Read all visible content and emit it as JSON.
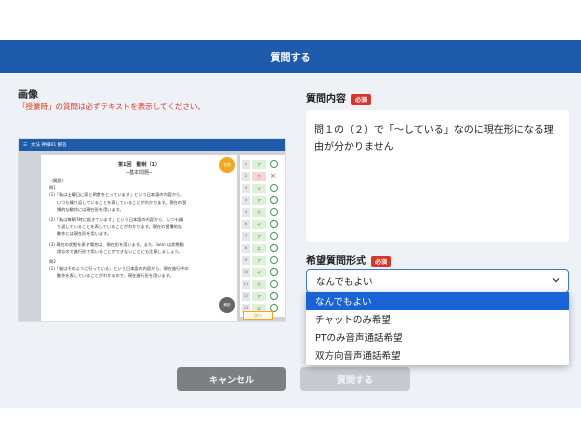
{
  "modal": {
    "title": "質問する"
  },
  "image_section": {
    "label": "画像",
    "warning": "「授業時」の質問は必ずテキストを表示してください。",
    "preview": {
      "app_bar": "文法 神様61 解答",
      "doc_title": "第1回　動制（1）",
      "doc_subtitle": "─基本問題─",
      "doc_lines": [
        "〈解説〉",
        "問1",
        "(1)「私は土曜日に家と朝食をとっています」という日本語の内容から、",
        "いつも繰り返していることを表していることがわかります。現在の習",
        "慣的な動作には現在形を用います。",
        "(2)「私は毎朝7時に起きています」という日本語の内容から、いつも繰",
        "り返していることを表していることがわかります。現在の習慣的な",
        "動作には現在形を用います。",
        "(3) 現在の状態を表す場合は、現在形を用います。また、bem は状態動",
        "詞なので進行形で用いることができないことにも注意しましょう。",
        "問2",
        "(1)「彼はそのように行っている」という日本語の内容から、現在進行中の",
        "動作を表していることがわかるので、現在進行形を用います。"
      ],
      "side_btn_1": "質問",
      "side_btn_2": "解説",
      "answer_rows": [
        {
          "num": "1",
          "val": "ア",
          "status": "ok"
        },
        {
          "num": "2",
          "val": "ウ",
          "status": "bad"
        },
        {
          "num": "3",
          "val": "イ",
          "status": "ok"
        },
        {
          "num": "4",
          "val": "ア",
          "status": "ok"
        },
        {
          "num": "5",
          "val": "ウ",
          "status": "ok"
        },
        {
          "num": "6",
          "val": "イ",
          "status": "ok"
        },
        {
          "num": "7",
          "val": "ア",
          "status": "ok"
        },
        {
          "num": "8",
          "val": "エ",
          "status": "ok"
        },
        {
          "num": "9",
          "val": "ア",
          "status": "ok"
        },
        {
          "num": "10",
          "val": "イ",
          "status": "ok"
        },
        {
          "num": "11",
          "val": "ウ",
          "status": "ok"
        },
        {
          "num": "12",
          "val": "ア",
          "status": "ok"
        },
        {
          "num": "13",
          "val": "エ",
          "status": "ok"
        }
      ],
      "next_btn": "次へ"
    }
  },
  "question_section": {
    "label": "質問内容",
    "required": "必須",
    "text": "問１の（２）で「〜している」なのに現在形になる理由が分かりません"
  },
  "format_section": {
    "label": "希望質問形式",
    "required": "必須",
    "selected": "なんでもよい",
    "options": [
      "なんでもよい",
      "チャットのみ希望",
      "PTのみ音声通話希望",
      "双方向音声通話希望"
    ]
  },
  "buttons": {
    "cancel": "キャンセル",
    "submit": "質問する"
  },
  "colors": {
    "brand": "#1e5bab",
    "required": "#d9362b",
    "highlight": "#1a63d6"
  }
}
